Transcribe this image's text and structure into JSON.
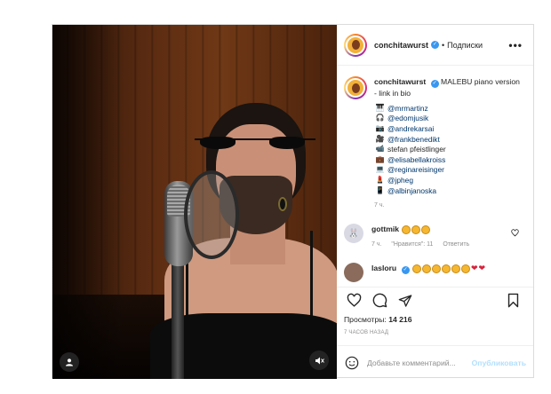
{
  "post": {
    "author": "conchitawurst",
    "follow_separator": "•",
    "follow_status": "Подписки",
    "more_label": "•••",
    "caption_text": "MALEBU piano version - link in bio",
    "credits": [
      {
        "icon": "piano-icon",
        "glyph": "🎹",
        "text": "@mrmartinz",
        "mention": true
      },
      {
        "icon": "headphones-icon",
        "glyph": "🎧",
        "text": "@edomjusik",
        "mention": true
      },
      {
        "icon": "camera-icon",
        "glyph": "📷",
        "text": "@andrekarsai",
        "mention": true
      },
      {
        "icon": "film-camera-icon",
        "glyph": "🎥",
        "text": "@frankbenedikt",
        "mention": true
      },
      {
        "icon": "video-camera-icon",
        "glyph": "📹",
        "text": "stefan pfeistlinger",
        "mention": false
      },
      {
        "icon": "briefcase-icon",
        "glyph": "💼",
        "text": "@elisabellakroiss",
        "mention": true
      },
      {
        "icon": "monitor-icon",
        "glyph": "💻",
        "text": "@reginareisinger",
        "mention": true
      },
      {
        "icon": "lipstick-icon",
        "glyph": "💄",
        "text": "@jpheg",
        "mention": true
      },
      {
        "icon": "phone-icon",
        "glyph": "📱",
        "text": "@albinjanoska",
        "mention": true
      }
    ],
    "caption_time": "7 ч.",
    "comments": [
      {
        "user": "gottmik",
        "emoji_count": 3,
        "time": "7 ч.",
        "likes": "\"Нравится\": 11",
        "reply": "Ответить"
      },
      {
        "user": "lasloru",
        "emoji_count": 6,
        "hearts": 2
      }
    ],
    "views_label": "Просмотры:",
    "views_count": "14 216",
    "posted_ago": "7 ЧАСОВ НАЗАД",
    "comment_placeholder": "Добавьте комментарий...",
    "publish_label": "Опубликовать"
  },
  "colors": {
    "verified": "#3897f0",
    "link": "#00376b",
    "muted": "#8e8e8e",
    "publish_disabled": "#b2dffc"
  }
}
